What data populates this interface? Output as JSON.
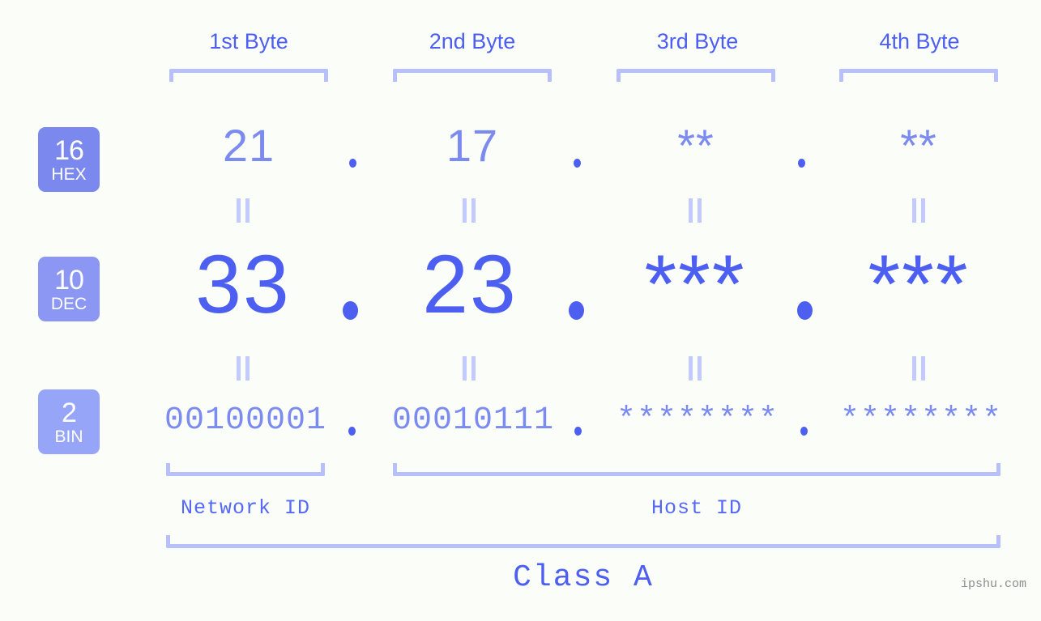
{
  "page": {
    "background": "#fbfdf9",
    "accent": "#4c5ff0",
    "accent_light": "#7b8bf0",
    "bracket_color": "#b7c0fb",
    "watermark": "ipshu.com"
  },
  "byte_headers": [
    {
      "label": "1st Byte"
    },
    {
      "label": "2nd Byte"
    },
    {
      "label": "3rd Byte"
    },
    {
      "label": "4th Byte"
    }
  ],
  "rows": [
    {
      "base_number": "16",
      "base_name": "HEX",
      "badge_color": "#7b89ef",
      "values": [
        "21",
        "17",
        "**",
        "**"
      ],
      "separator": "."
    },
    {
      "base_number": "10",
      "base_name": "DEC",
      "badge_color": "#8b97f2",
      "values": [
        "33",
        "23",
        "***",
        "***"
      ],
      "separator": "."
    },
    {
      "base_number": "2",
      "base_name": "BIN",
      "badge_color": "#96a5f7",
      "values": [
        "00100001",
        "00010111",
        "********",
        "********"
      ],
      "separator": "."
    }
  ],
  "id_sections": [
    {
      "label": "Network ID"
    },
    {
      "label": "Host ID"
    }
  ],
  "class": {
    "label": "Class A"
  },
  "equals_sign": "="
}
